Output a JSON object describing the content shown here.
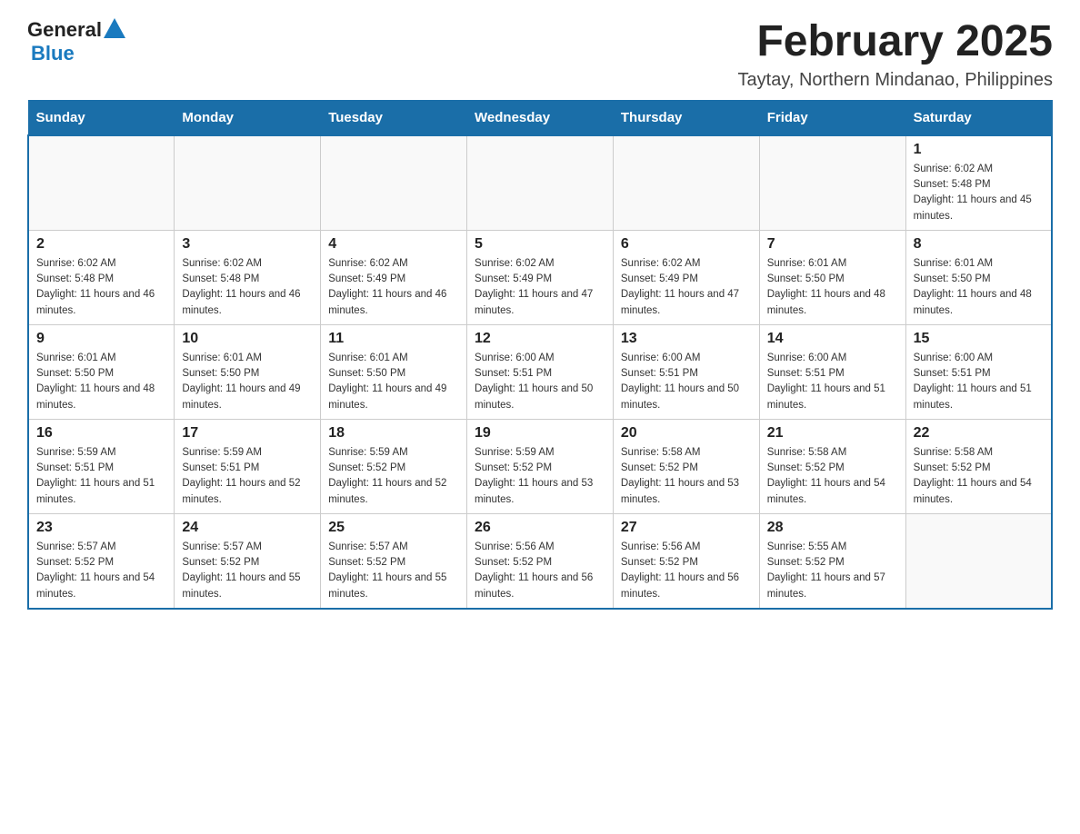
{
  "header": {
    "logo_general": "General",
    "logo_blue": "Blue",
    "title": "February 2025",
    "subtitle": "Taytay, Northern Mindanao, Philippines"
  },
  "days_of_week": [
    "Sunday",
    "Monday",
    "Tuesday",
    "Wednesday",
    "Thursday",
    "Friday",
    "Saturday"
  ],
  "weeks": [
    [
      {
        "day": "",
        "info": ""
      },
      {
        "day": "",
        "info": ""
      },
      {
        "day": "",
        "info": ""
      },
      {
        "day": "",
        "info": ""
      },
      {
        "day": "",
        "info": ""
      },
      {
        "day": "",
        "info": ""
      },
      {
        "day": "1",
        "info": "Sunrise: 6:02 AM\nSunset: 5:48 PM\nDaylight: 11 hours and 45 minutes."
      }
    ],
    [
      {
        "day": "2",
        "info": "Sunrise: 6:02 AM\nSunset: 5:48 PM\nDaylight: 11 hours and 46 minutes."
      },
      {
        "day": "3",
        "info": "Sunrise: 6:02 AM\nSunset: 5:48 PM\nDaylight: 11 hours and 46 minutes."
      },
      {
        "day": "4",
        "info": "Sunrise: 6:02 AM\nSunset: 5:49 PM\nDaylight: 11 hours and 46 minutes."
      },
      {
        "day": "5",
        "info": "Sunrise: 6:02 AM\nSunset: 5:49 PM\nDaylight: 11 hours and 47 minutes."
      },
      {
        "day": "6",
        "info": "Sunrise: 6:02 AM\nSunset: 5:49 PM\nDaylight: 11 hours and 47 minutes."
      },
      {
        "day": "7",
        "info": "Sunrise: 6:01 AM\nSunset: 5:50 PM\nDaylight: 11 hours and 48 minutes."
      },
      {
        "day": "8",
        "info": "Sunrise: 6:01 AM\nSunset: 5:50 PM\nDaylight: 11 hours and 48 minutes."
      }
    ],
    [
      {
        "day": "9",
        "info": "Sunrise: 6:01 AM\nSunset: 5:50 PM\nDaylight: 11 hours and 48 minutes."
      },
      {
        "day": "10",
        "info": "Sunrise: 6:01 AM\nSunset: 5:50 PM\nDaylight: 11 hours and 49 minutes."
      },
      {
        "day": "11",
        "info": "Sunrise: 6:01 AM\nSunset: 5:50 PM\nDaylight: 11 hours and 49 minutes."
      },
      {
        "day": "12",
        "info": "Sunrise: 6:00 AM\nSunset: 5:51 PM\nDaylight: 11 hours and 50 minutes."
      },
      {
        "day": "13",
        "info": "Sunrise: 6:00 AM\nSunset: 5:51 PM\nDaylight: 11 hours and 50 minutes."
      },
      {
        "day": "14",
        "info": "Sunrise: 6:00 AM\nSunset: 5:51 PM\nDaylight: 11 hours and 51 minutes."
      },
      {
        "day": "15",
        "info": "Sunrise: 6:00 AM\nSunset: 5:51 PM\nDaylight: 11 hours and 51 minutes."
      }
    ],
    [
      {
        "day": "16",
        "info": "Sunrise: 5:59 AM\nSunset: 5:51 PM\nDaylight: 11 hours and 51 minutes."
      },
      {
        "day": "17",
        "info": "Sunrise: 5:59 AM\nSunset: 5:51 PM\nDaylight: 11 hours and 52 minutes."
      },
      {
        "day": "18",
        "info": "Sunrise: 5:59 AM\nSunset: 5:52 PM\nDaylight: 11 hours and 52 minutes."
      },
      {
        "day": "19",
        "info": "Sunrise: 5:59 AM\nSunset: 5:52 PM\nDaylight: 11 hours and 53 minutes."
      },
      {
        "day": "20",
        "info": "Sunrise: 5:58 AM\nSunset: 5:52 PM\nDaylight: 11 hours and 53 minutes."
      },
      {
        "day": "21",
        "info": "Sunrise: 5:58 AM\nSunset: 5:52 PM\nDaylight: 11 hours and 54 minutes."
      },
      {
        "day": "22",
        "info": "Sunrise: 5:58 AM\nSunset: 5:52 PM\nDaylight: 11 hours and 54 minutes."
      }
    ],
    [
      {
        "day": "23",
        "info": "Sunrise: 5:57 AM\nSunset: 5:52 PM\nDaylight: 11 hours and 54 minutes."
      },
      {
        "day": "24",
        "info": "Sunrise: 5:57 AM\nSunset: 5:52 PM\nDaylight: 11 hours and 55 minutes."
      },
      {
        "day": "25",
        "info": "Sunrise: 5:57 AM\nSunset: 5:52 PM\nDaylight: 11 hours and 55 minutes."
      },
      {
        "day": "26",
        "info": "Sunrise: 5:56 AM\nSunset: 5:52 PM\nDaylight: 11 hours and 56 minutes."
      },
      {
        "day": "27",
        "info": "Sunrise: 5:56 AM\nSunset: 5:52 PM\nDaylight: 11 hours and 56 minutes."
      },
      {
        "day": "28",
        "info": "Sunrise: 5:55 AM\nSunset: 5:52 PM\nDaylight: 11 hours and 57 minutes."
      },
      {
        "day": "",
        "info": ""
      }
    ]
  ]
}
